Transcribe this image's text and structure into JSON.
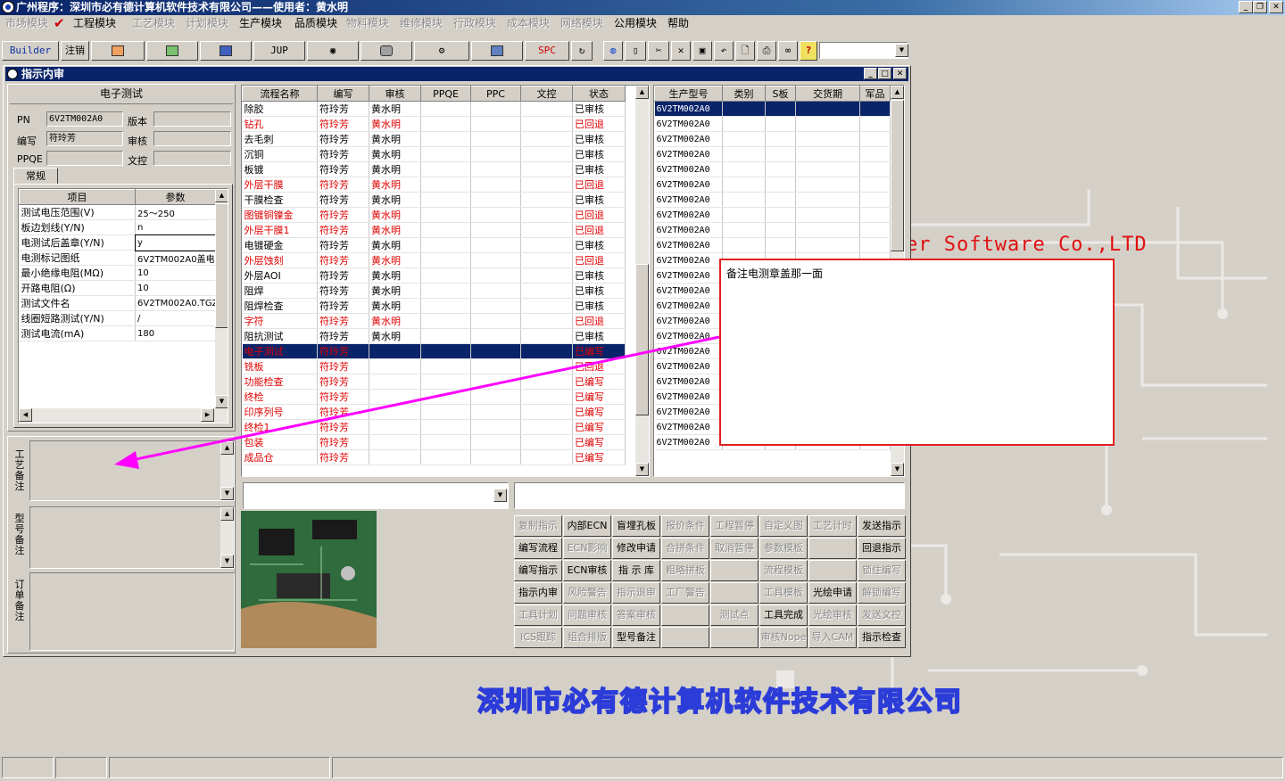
{
  "app": {
    "title": "广州程序：深圳市必有德计算机软件技术有限公司——使用者：黄水明"
  },
  "menu": [
    {
      "label": "市场模块",
      "enabled": false
    },
    {
      "label": "工程模块",
      "enabled": true,
      "checked": true
    },
    {
      "label": "工艺模块",
      "enabled": false
    },
    {
      "label": "计划模块",
      "enabled": false
    },
    {
      "label": "生产模块",
      "enabled": true
    },
    {
      "label": "品质模块",
      "enabled": true
    },
    {
      "label": "物料模块",
      "enabled": false
    },
    {
      "label": "维修模块",
      "enabled": false
    },
    {
      "label": "行政模块",
      "enabled": false
    },
    {
      "label": "成本模块",
      "enabled": false
    },
    {
      "label": "网络模块",
      "enabled": false
    },
    {
      "label": "公用模块",
      "enabled": true
    },
    {
      "label": "帮助",
      "enabled": true
    }
  ],
  "toolbar": {
    "builder": "Builder",
    "logout": "注销",
    "jup": "JUP",
    "spc": "SPC"
  },
  "watermark": {
    "en": "er Software Co.,LTD",
    "cn": "深圳市必有德计算机软件技术有限公司"
  },
  "window": {
    "title": "指示内审"
  },
  "info": {
    "section_title": "电子测试",
    "pn_label": "PN",
    "pn_value": "6V2TM002A0",
    "version_label": "版本",
    "version_value": "",
    "author_label": "编写",
    "author_value": "符玲芳",
    "review_label": "审核",
    "review_value": "",
    "ppqe_label": "PPQE",
    "ppqe_value": "",
    "dc_label": "文控",
    "dc_value": "",
    "tab": "常规"
  },
  "params": {
    "headers": [
      "项目",
      "参数"
    ],
    "rows": [
      [
        "测试电压范围(V)",
        "25～250"
      ],
      [
        "板边划线(Y/N)",
        "n"
      ],
      [
        "电测试后盖章(Y/N)",
        "y"
      ],
      [
        "电测标记图纸",
        "6V2TM002A0盖电测"
      ],
      [
        "最小绝缘电阻(MΩ)",
        "10"
      ],
      [
        "开路电阻(Ω)",
        "10"
      ],
      [
        "测试文件名",
        "6V2TM002A0.TGZ"
      ],
      [
        "线圈短路测试(Y/N)",
        "/"
      ],
      [
        "测试电流(mA)",
        "180"
      ]
    ]
  },
  "remarks": {
    "process": "工艺备注",
    "model": "型号备注",
    "order": "订单备注"
  },
  "flow": {
    "headers": [
      "流程名称",
      "编写",
      "审核",
      "PPQE",
      "PPC",
      "文控",
      "状态"
    ],
    "rows": [
      {
        "c": [
          "除胶",
          "符玲芳",
          "黄水明",
          "",
          "",
          "",
          "已审核"
        ],
        "style": ""
      },
      {
        "c": [
          "钻孔",
          "符玲芳",
          "黄水明",
          "",
          "",
          "",
          "已回退"
        ],
        "style": "red"
      },
      {
        "c": [
          "去毛刺",
          "符玲芳",
          "黄水明",
          "",
          "",
          "",
          "已审核"
        ],
        "style": ""
      },
      {
        "c": [
          "沉铜",
          "符玲芳",
          "黄水明",
          "",
          "",
          "",
          "已审核"
        ],
        "style": ""
      },
      {
        "c": [
          "板镀",
          "符玲芳",
          "黄水明",
          "",
          "",
          "",
          "已审核"
        ],
        "style": ""
      },
      {
        "c": [
          "外层干膜",
          "符玲芳",
          "黄水明",
          "",
          "",
          "",
          "已回退"
        ],
        "style": "red"
      },
      {
        "c": [
          "干膜检查",
          "符玲芳",
          "黄水明",
          "",
          "",
          "",
          "已审核"
        ],
        "style": ""
      },
      {
        "c": [
          "图镀铜镍金",
          "符玲芳",
          "黄水明",
          "",
          "",
          "",
          "已回退"
        ],
        "style": "red"
      },
      {
        "c": [
          "外层干膜1",
          "符玲芳",
          "黄水明",
          "",
          "",
          "",
          "已回退"
        ],
        "style": "red"
      },
      {
        "c": [
          "电镀硬金",
          "符玲芳",
          "黄水明",
          "",
          "",
          "",
          "已审核"
        ],
        "style": ""
      },
      {
        "c": [
          "外层蚀刻",
          "符玲芳",
          "黄水明",
          "",
          "",
          "",
          "已回退"
        ],
        "style": "red"
      },
      {
        "c": [
          "外层AOI",
          "符玲芳",
          "黄水明",
          "",
          "",
          "",
          "已审核"
        ],
        "style": ""
      },
      {
        "c": [
          "阻焊",
          "符玲芳",
          "黄水明",
          "",
          "",
          "",
          "已审核"
        ],
        "style": ""
      },
      {
        "c": [
          "阻焊检查",
          "符玲芳",
          "黄水明",
          "",
          "",
          "",
          "已审核"
        ],
        "style": ""
      },
      {
        "c": [
          "字符",
          "符玲芳",
          "黄水明",
          "",
          "",
          "",
          "已回退"
        ],
        "style": "red"
      },
      {
        "c": [
          "阻抗测试",
          "符玲芳",
          "黄水明",
          "",
          "",
          "",
          "已审核"
        ],
        "style": ""
      },
      {
        "c": [
          "电子测试",
          "符玲芳",
          "",
          "",
          "",
          "",
          "已编写"
        ],
        "style": "sel"
      },
      {
        "c": [
          "铣板",
          "符玲芳",
          "",
          "",
          "",
          "",
          "已回退"
        ],
        "style": "red"
      },
      {
        "c": [
          "功能检查",
          "符玲芳",
          "",
          "",
          "",
          "",
          "已编写"
        ],
        "style": "red"
      },
      {
        "c": [
          "终检",
          "符玲芳",
          "",
          "",
          "",
          "",
          "已编写"
        ],
        "style": "red"
      },
      {
        "c": [
          "印序列号",
          "符玲芳",
          "",
          "",
          "",
          "",
          "已编写"
        ],
        "style": "red"
      },
      {
        "c": [
          "终检1",
          "符玲芳",
          "",
          "",
          "",
          "",
          "已编写"
        ],
        "style": "red"
      },
      {
        "c": [
          "包装",
          "符玲芳",
          "",
          "",
          "",
          "",
          "已编写"
        ],
        "style": "red"
      },
      {
        "c": [
          "成品仓",
          "符玲芳",
          "",
          "",
          "",
          "",
          "已编写"
        ],
        "style": "red"
      }
    ]
  },
  "models": {
    "headers": [
      "生产型号",
      "类别",
      "S板",
      "交货期",
      "军品"
    ],
    "value": "6V2TM002A0",
    "count": 23
  },
  "note": {
    "text": "备注电测章盖那一面"
  },
  "actions": [
    [
      {
        "l": "复制指示",
        "e": false
      },
      {
        "l": "内部ECN",
        "e": true
      },
      {
        "l": "盲埋孔板",
        "e": true
      },
      {
        "l": "报价条件",
        "e": false
      },
      {
        "l": "工程暂停",
        "e": false
      },
      {
        "l": "自定义图",
        "e": false
      },
      {
        "l": "工艺计时",
        "e": false
      },
      {
        "l": "发送指示",
        "e": true
      }
    ],
    [
      {
        "l": "编写流程",
        "e": true
      },
      {
        "l": "ECN影响",
        "e": false
      },
      {
        "l": "修改申请",
        "e": true
      },
      {
        "l": "合拼条件",
        "e": false
      },
      {
        "l": "取消暂停",
        "e": false
      },
      {
        "l": "参数模板",
        "e": false
      },
      {
        "l": "",
        "e": false
      },
      {
        "l": "回退指示",
        "e": true
      }
    ],
    [
      {
        "l": "编写指示",
        "e": true
      },
      {
        "l": "ECN审核",
        "e": true
      },
      {
        "l": "指 示 库",
        "e": true
      },
      {
        "l": "粗略拼板",
        "e": false
      },
      {
        "l": "",
        "e": false
      },
      {
        "l": "流程模板",
        "e": false
      },
      {
        "l": "",
        "e": false
      },
      {
        "l": "锁住编写",
        "e": false
      }
    ],
    [
      {
        "l": "指示内审",
        "e": true
      },
      {
        "l": "风险警告",
        "e": false
      },
      {
        "l": "指示退审",
        "e": false
      },
      {
        "l": "工厂警告",
        "e": false
      },
      {
        "l": "",
        "e": false
      },
      {
        "l": "工具模板",
        "e": false
      },
      {
        "l": "光绘申请",
        "e": true
      },
      {
        "l": "解锁编写",
        "e": false
      }
    ],
    [
      {
        "l": "工具计划",
        "e": false
      },
      {
        "l": "问题审核",
        "e": false
      },
      {
        "l": "答案审核",
        "e": false
      },
      {
        "l": "",
        "e": false
      },
      {
        "l": "测试点",
        "e": false
      },
      {
        "l": "工具完成",
        "e": true
      },
      {
        "l": "光绘审核",
        "e": false
      },
      {
        "l": "发送文控",
        "e": false
      }
    ],
    [
      {
        "l": "ICS跟踪",
        "e": false
      },
      {
        "l": "组合排版",
        "e": false
      },
      {
        "l": "型号备注",
        "e": true
      },
      {
        "l": "",
        "e": false
      },
      {
        "l": "",
        "e": false
      },
      {
        "l": "审核Nope",
        "e": false
      },
      {
        "l": "导入CAM",
        "e": false
      },
      {
        "l": "指示检查",
        "e": true
      }
    ]
  ],
  "colors": {
    "accent": "#0a246a",
    "arrow": "#ff00ff",
    "note_border": "#e02020",
    "reject_text": "#e00000"
  }
}
